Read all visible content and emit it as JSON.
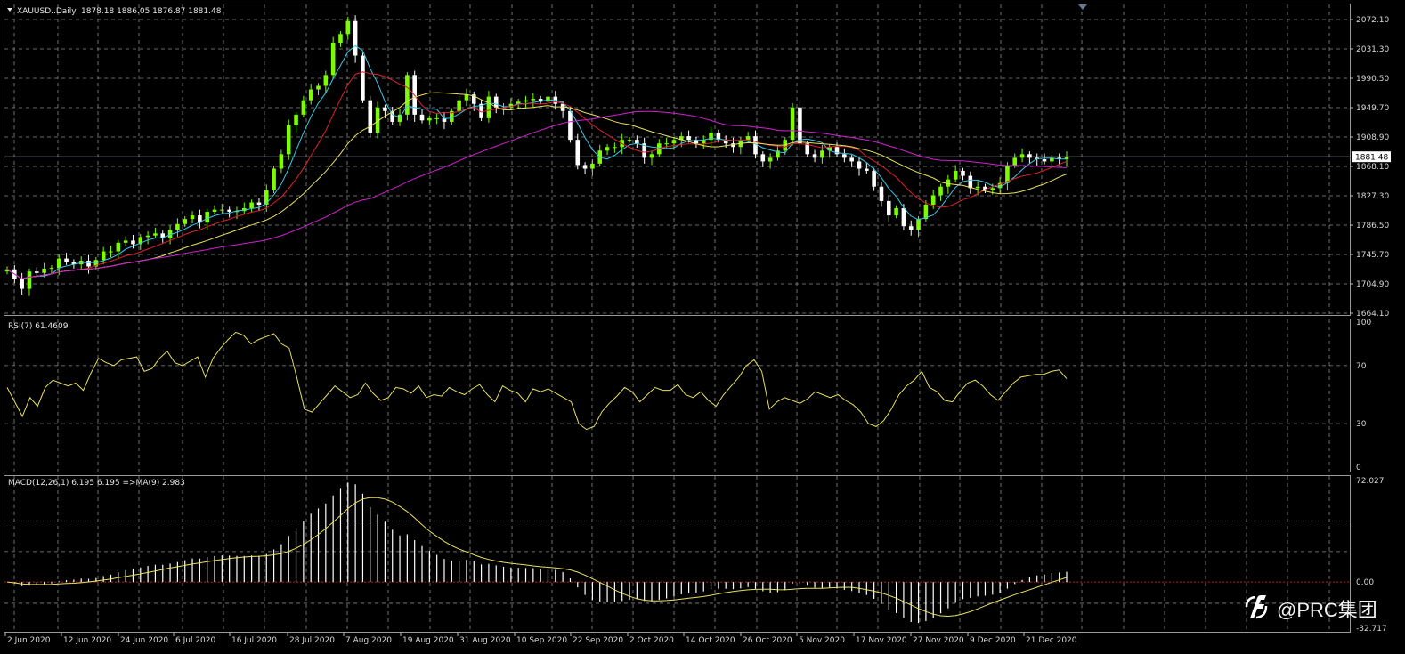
{
  "header": {
    "symbol": "XAUUSD..Daily",
    "ohlc": "1878.18 1886.05 1876.87 1881.48",
    "rsi_label": "RSI(7) 61.4609",
    "macd_label": "MACD(12,26,1) 6.195 6.195 =>MA(9) 2.983"
  },
  "watermark": {
    "text": "@PRC集团",
    "icon": "prc-logo-icon"
  },
  "colors": {
    "background": "#000000",
    "grid": "#8a8a8a",
    "bull_candle": "#7CFC00",
    "bear_candle": "#ffffff",
    "ma_fast": "#38c8e8",
    "ma_mid": "#e0202a",
    "ma_slow": "#e8e060",
    "ma_long": "#d020d0",
    "rsi": "#e8e060",
    "macd_hist": "#ffffff",
    "macd_signal": "#e8e060",
    "zero_line": "#c01a1a"
  },
  "chart_data": [
    {
      "type": "candlestick",
      "title": "XAUUSD..Daily",
      "x_tick_labels": [
        "2 Jun 2020",
        "12 Jun 2020",
        "24 Jun 2020",
        "6 Jul 2020",
        "16 Jul 2020",
        "28 Jul 2020",
        "7 Aug 2020",
        "19 Aug 2020",
        "31 Aug 2020",
        "10 Sep 2020",
        "22 Sep 2020",
        "2 Oct 2020",
        "14 Oct 2020",
        "26 Oct 2020",
        "5 Nov 2020",
        "17 Nov 2020",
        "27 Nov 2020",
        "9 Dec 2020",
        "21 Dec 2020"
      ],
      "y_tick_labels": [
        "2072.10",
        "2031.30",
        "1990.50",
        "1949.70",
        "1908.90",
        "1868.10",
        "1827.30",
        "1786.50",
        "1745.70",
        "1704.90",
        "1664.10"
      ],
      "ylim": [
        1664.1,
        2072.1
      ],
      "current_price": "1881.48",
      "close": [
        1725,
        1712,
        1698,
        1722,
        1720,
        1726,
        1727,
        1740,
        1735,
        1732,
        1737,
        1729,
        1738,
        1750,
        1750,
        1762,
        1765,
        1760,
        1770,
        1772,
        1775,
        1768,
        1780,
        1788,
        1795,
        1800,
        1790,
        1805,
        1808,
        1808,
        1805,
        1806,
        1810,
        1818,
        1815,
        1835,
        1865,
        1885,
        1925,
        1940,
        1960,
        1975,
        1980,
        1995,
        2040,
        2052,
        2070,
        2022,
        1960,
        1915,
        1950,
        1945,
        1930,
        1940,
        1995,
        1940,
        1932,
        1935,
        1935,
        1930,
        1945,
        1960,
        1968,
        1955,
        1935,
        1965,
        1950,
        1950,
        1955,
        1958,
        1960,
        1962,
        1958,
        1965,
        1955,
        1945,
        1905,
        1870,
        1865,
        1872,
        1890,
        1895,
        1895,
        1905,
        1905,
        1900,
        1880,
        1885,
        1900,
        1900,
        1905,
        1910,
        1905,
        1900,
        1905,
        1915,
        1905,
        1900,
        1895,
        1905,
        1910,
        1885,
        1875,
        1880,
        1890,
        1905,
        1950,
        1900,
        1885,
        1880,
        1890,
        1895,
        1885,
        1880,
        1875,
        1865,
        1862,
        1840,
        1820,
        1800,
        1810,
        1785,
        1780,
        1795,
        1815,
        1828,
        1840,
        1850,
        1862,
        1855,
        1838,
        1840,
        1835,
        1838,
        1845,
        1870,
        1880,
        1885,
        1880,
        1878,
        1875,
        1880,
        1878,
        1881
      ],
      "series": [
        {
          "name": "MA fast",
          "values": []
        },
        {
          "name": "MA mid",
          "values": []
        },
        {
          "name": "MA slow",
          "values": []
        },
        {
          "name": "MA long",
          "values": []
        }
      ]
    },
    {
      "type": "line",
      "title": "RSI(7) 61.4609",
      "y_tick_labels": [
        "100",
        "70",
        "30",
        "0"
      ],
      "ylim": [
        0,
        100
      ],
      "values": [
        55,
        45,
        35,
        48,
        42,
        55,
        60,
        58,
        56,
        58,
        53,
        65,
        75,
        72,
        70,
        74,
        75,
        76,
        66,
        68,
        75,
        80,
        72,
        70,
        73,
        76,
        62,
        75,
        82,
        88,
        93,
        91,
        85,
        88,
        90,
        92,
        85,
        82,
        62,
        40,
        38,
        44,
        50,
        56,
        52,
        48,
        50,
        58,
        51,
        46,
        48,
        55,
        54,
        51,
        56,
        48,
        50,
        49,
        55,
        52,
        50,
        54,
        57,
        50,
        45,
        56,
        53,
        51,
        45,
        54,
        52,
        54,
        51,
        48,
        45,
        30,
        26,
        28,
        38,
        44,
        49,
        55,
        52,
        45,
        50,
        55,
        53,
        53,
        57,
        50,
        48,
        52,
        46,
        42,
        50,
        56,
        62,
        70,
        74,
        66,
        40,
        45,
        48,
        46,
        44,
        47,
        52,
        50,
        48,
        50,
        46,
        43,
        38,
        30,
        28,
        32,
        40,
        50,
        56,
        60,
        66,
        55,
        52,
        46,
        45,
        52,
        58,
        60,
        56,
        50,
        46,
        52,
        58,
        62,
        63,
        64,
        64,
        66,
        67,
        61
      ],
      "reference_levels": [
        70,
        30
      ]
    },
    {
      "type": "bar",
      "title": "MACD(12,26,1) 6.195 6.195 =>MA(9) 2.983",
      "y_tick_labels": [
        "72.027",
        "0.00",
        "-32.717"
      ],
      "ylim": [
        -32.717,
        72.027
      ],
      "macd_main": [],
      "signal": []
    }
  ]
}
